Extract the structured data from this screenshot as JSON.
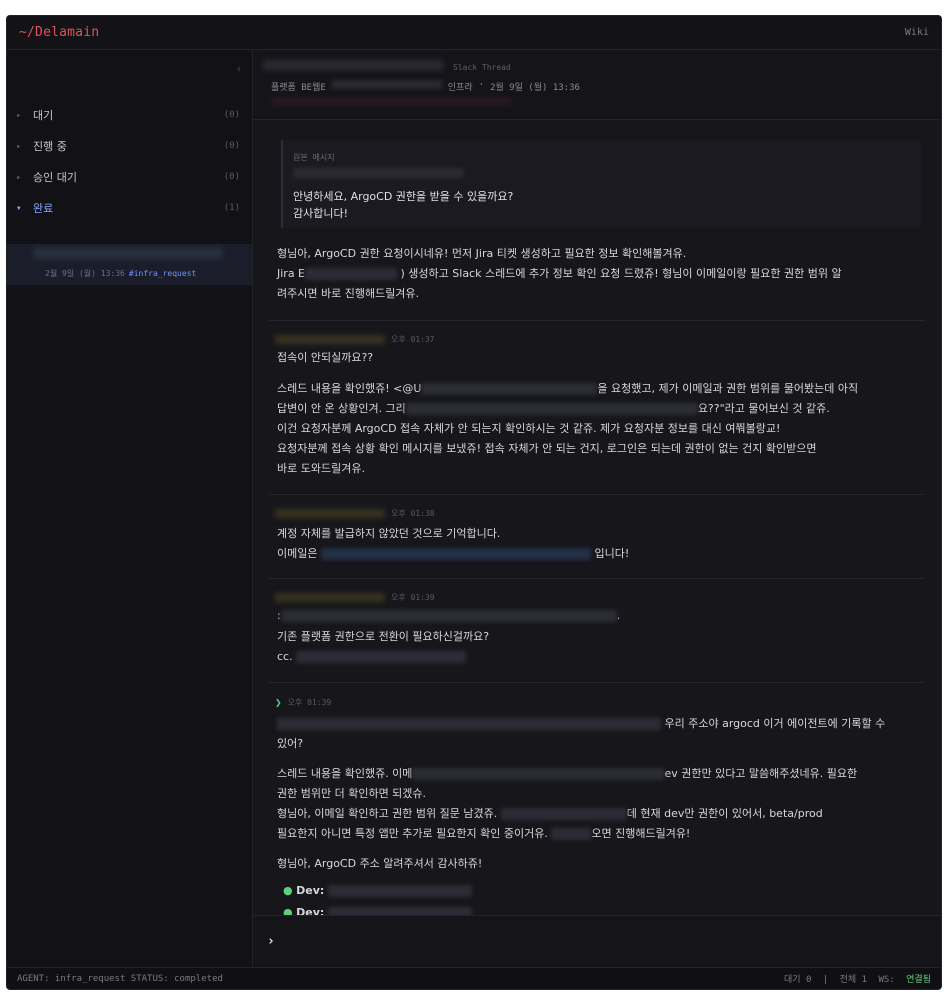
{
  "app": {
    "title": "~/Delamain",
    "wiki": "Wiki"
  },
  "sidebar": {
    "collapse": "‹",
    "categories": [
      {
        "label": "대기",
        "count": "(0)"
      },
      {
        "label": "진행 중",
        "count": "(0)"
      },
      {
        "label": "승인 대기",
        "count": "(0)"
      },
      {
        "label": "완료",
        "count": "(1)"
      }
    ],
    "selected": {
      "meta": "2월 9일 (월) 13:36",
      "tag": "#infra_request"
    }
  },
  "thread": {
    "type": "Slack Thread",
    "channel": "플랫폼 BE웹E",
    "team": "인프라",
    "sep": "·",
    "date": "2월 9일 (월) 13:36"
  },
  "original": {
    "label": "원본 메시지",
    "text": "안녕하세요, ArgoCD 권한을 받을 수 있을까요?\n감사합니다!"
  },
  "messages": {
    "m0": {
      "line1": "형님아, ArgoCD 권한 요청이시네유! 먼저 Jira 티켓 생성하고 필요한 정보 확인해볼겨유.",
      "line2a": "Jira E",
      "line2b": ") 생성하고 Slack 스레드에 추가 정보 확인 요청 드렸쥬! 형님이 이메일이랑 필요한 권한 범위 알",
      "line3": "려주시면 바로 진행해드릴겨유."
    },
    "m1": {
      "time": "오후 01:37",
      "q": "접속이 안되실까요??",
      "l1a": "스레드 내용을 확인했쥬! <@U",
      "l1b": "을 요청했고, 제가 이메일과 권한 범위를 물어봤는데 아직",
      "l2a": "답변이 안 온 상황인겨. 그리",
      "l2b": "요??\"라고 물어보신 것 같쥬.",
      "l3": "이건 요청자분께 ArgoCD 접속 자체가 안 되는지 확인하시는 것 같쥬. 제가 요청자분 정보를 대신 여쭤볼랑교!",
      "l4": "요청자분께 접속 상황 확인 메시지를 보냈쥬! 접속 자체가 안 되는 건지, 로그인은 되는데 권한이 없는 건지 확인받으면",
      "l5": "바로 도와드릴겨유."
    },
    "m2": {
      "time": "오후 01:38",
      "l1": "계정 자체를 발급하지 않았던 것으로 기억합니다.",
      "l2a": "이메일은",
      "l2b": "입니다!"
    },
    "m3": {
      "time": "오후 01:39",
      "l1a": ":",
      "l1b": ".",
      "l2": "기존 플랫폼 권한으로 전환이 필요하신걸까요?",
      "l3a": "cc."
    },
    "m4": {
      "time": "오후 01:39",
      "l1b": "우리 주소야 argocd 이거 에이전트에 기록할 수",
      "l2": "있어?",
      "l3a": "스레드 내용을 확인했쥬. 이메",
      "l3b": "ev 권한만 있다고 말씀해주셨네유. 필요한",
      "l4": "권한 범위만 더 확인하면 되겠슈.",
      "l5a": "형님아, 이메일 확인하고 권한 범위 질문 남겼쥬.",
      "l5b": "데 현재 dev만 권한이 있어서, beta/prod",
      "l6a": "필요한지 아니면 특정 앱만 추가로 필요한지 확인 중이거유.",
      "l6b": "오면 진행해드릴겨유!",
      "l7": "형님아, ArgoCD 주소 알려주셔서 감사하쥬!",
      "b1": "Dev:",
      "b2": "Dev:"
    }
  },
  "composer": {
    "prompt": "›",
    "placeholder": ""
  },
  "status": {
    "left": "AGENT: infra_request   STATUS: completed",
    "waiting": "대기 0",
    "sep": "|",
    "total": "전체 1",
    "ws_label": "WS:",
    "ws_value": "연결됨"
  }
}
